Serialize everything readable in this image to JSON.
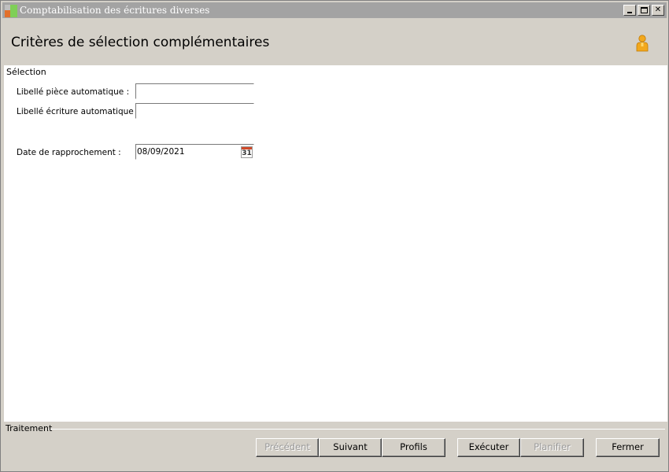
{
  "window": {
    "title": "Comptabilisation des écritures diverses",
    "controls": {
      "minimize": "_",
      "maximize": "□",
      "close": "✕"
    }
  },
  "header": {
    "title": "Critères de sélection complémentaires",
    "user_icon": "user-icon"
  },
  "selection": {
    "legend": "Sélection",
    "fields": [
      {
        "label": "Libellé pièce automatique :",
        "value": "",
        "placeholder": ""
      },
      {
        "label": "Libellé écriture automatique :",
        "value": "",
        "placeholder": ""
      },
      {
        "label": "Date de rapprochement :",
        "value": "08/09/2021",
        "placeholder": ""
      }
    ],
    "calendar_icon_text": "31"
  },
  "footer": {
    "legend": "Traitement",
    "buttons": {
      "previous": {
        "label": "Précédent",
        "enabled": false
      },
      "next": {
        "label": "Suivant",
        "enabled": true
      },
      "profiles": {
        "label": "Profils",
        "enabled": true
      },
      "execute": {
        "label": "Exécuter",
        "enabled": true
      },
      "schedule": {
        "label": "Planifier",
        "enabled": false
      },
      "close": {
        "label": "Fermer",
        "enabled": true
      }
    }
  }
}
